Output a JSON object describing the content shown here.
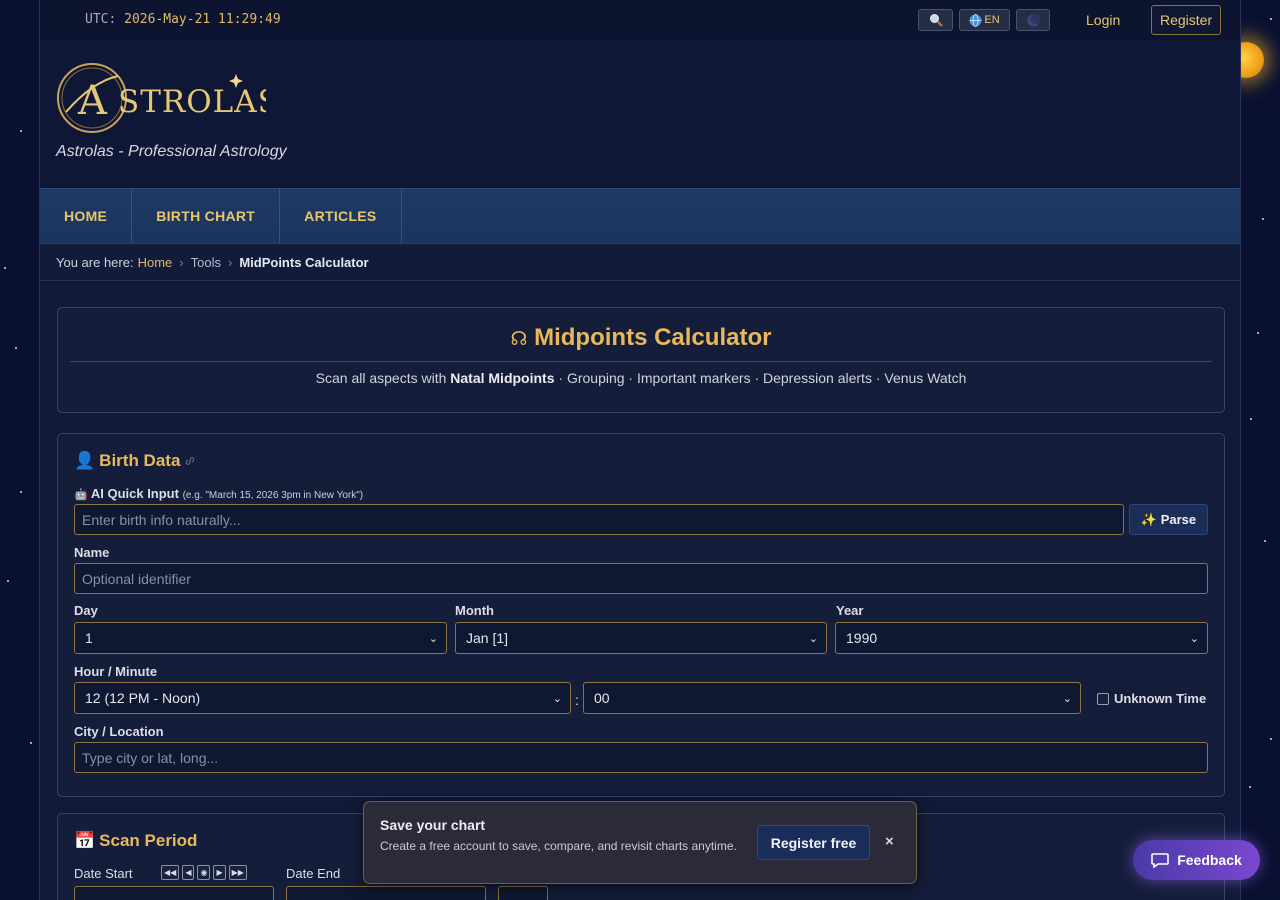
{
  "topbar": {
    "utc_label": "UTC:",
    "utc_time": "2026-May-21 11:29:49",
    "search_icon": "magnifier-icon",
    "lang_label": "EN",
    "theme_icon": "moon-icon",
    "login": "Login",
    "register": "Register"
  },
  "header": {
    "logo_text": "ASTROLAS",
    "tagline": "Astrolas - Professional Astrology"
  },
  "nav": {
    "items": [
      "HOME",
      "BIRTH CHART",
      "ARTICLES"
    ]
  },
  "breadcrumb": {
    "prefix": "You are here:",
    "home": "Home",
    "tools": "Tools",
    "current": "MidPoints Calculator"
  },
  "title_card": {
    "icon": "☊",
    "title": "Midpoints Calculator",
    "desc_before": "Scan all aspects with",
    "desc_bold": "Natal Midpoints",
    "desc_after": "· Grouping · Important markers · Depression alerts · Venus Watch"
  },
  "birth": {
    "title": "Birth Data",
    "title_icon": "👤",
    "ai_label": "AI Quick Input",
    "ai_icon": "🤖",
    "ai_hint": "(e.g. \"March 15, 2026 3pm in New York\")",
    "ai_placeholder": "Enter birth info naturally...",
    "parse": "✨ Parse",
    "name_label": "Name",
    "name_placeholder": "Optional identifier",
    "day_label": "Day",
    "day_value": "1",
    "month_label": "Month",
    "month_value": "Jan [1]",
    "year_label": "Year",
    "year_value": "1990",
    "hour_label": "Hour / Minute",
    "hour_value": "12 (12 PM - Noon)",
    "minute_value": "00",
    "unknown_time": "Unknown Time",
    "city_label": "City / Location",
    "city_placeholder": "Type city or lat, long..."
  },
  "scan": {
    "title": "Scan Period",
    "title_icon": "📅",
    "date_start_label": "Date Start",
    "date_end_label": "Date End",
    "step_buttons": [
      "◀◀",
      "◀",
      "◉",
      "▶",
      "▶▶"
    ]
  },
  "toast": {
    "title": "Save your chart",
    "body": "Create a free account to save, compare, and revisit charts anytime.",
    "button": "Register free",
    "close": "×"
  },
  "feedback": {
    "label": "Feedback"
  }
}
